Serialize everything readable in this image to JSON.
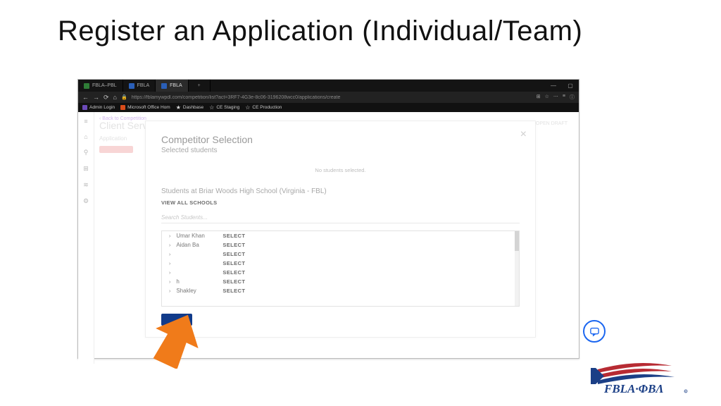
{
  "slide": {
    "title": "Register an Application (Individual/Team)"
  },
  "browser": {
    "tabs": [
      {
        "label": "FBLA–PBL"
      },
      {
        "label": "FBLA"
      },
      {
        "label": "FBLA"
      }
    ],
    "plus": "+",
    "window_min": "—",
    "window_max": "▢",
    "nav_back": "←",
    "nav_fwd": "→",
    "reload": "⟳",
    "home": "⌂",
    "lock": "🔒",
    "url": "https://fblamywpdl.com/competition/list?act=3RF7-4G3e-8c06-3196208wcc0/applications/create",
    "addr_icons": {
      "reader": "⊞",
      "star": "☆",
      "menu": "≡",
      "profile": "ⓘ",
      "ext": "⋯"
    },
    "bookmarks": [
      {
        "label": "Admin Login"
      },
      {
        "label": "Microsoft Office Hom"
      },
      {
        "label": "Dashbase"
      },
      {
        "label": "CE Staging"
      },
      {
        "label": "CE Production"
      }
    ]
  },
  "leftrail": {
    "icons": [
      "≡",
      "⌂",
      "⚲",
      "⊞",
      "≋",
      "⚙"
    ]
  },
  "background_page": {
    "back_link": "‹ Back to Competition",
    "header_ghost": "Client Service",
    "row_label": "Application",
    "right_ghost": "✎ OPEN DRAFT"
  },
  "modal": {
    "title": "Competitor Selection",
    "subtitle": "Selected students",
    "empty": "No students selected.",
    "section": "Students at Briar Woods High School (Virginia - FBL)",
    "view_all": "VIEW ALL SCHOOLS",
    "search_placeholder": "Search Students...",
    "select_label": "SELECT",
    "students": [
      "Umar Khan",
      "Aidan Ba",
      "",
      "",
      "",
      "  h",
      "Shakley"
    ]
  },
  "logo_text": "FBLA·ΦBΛ"
}
